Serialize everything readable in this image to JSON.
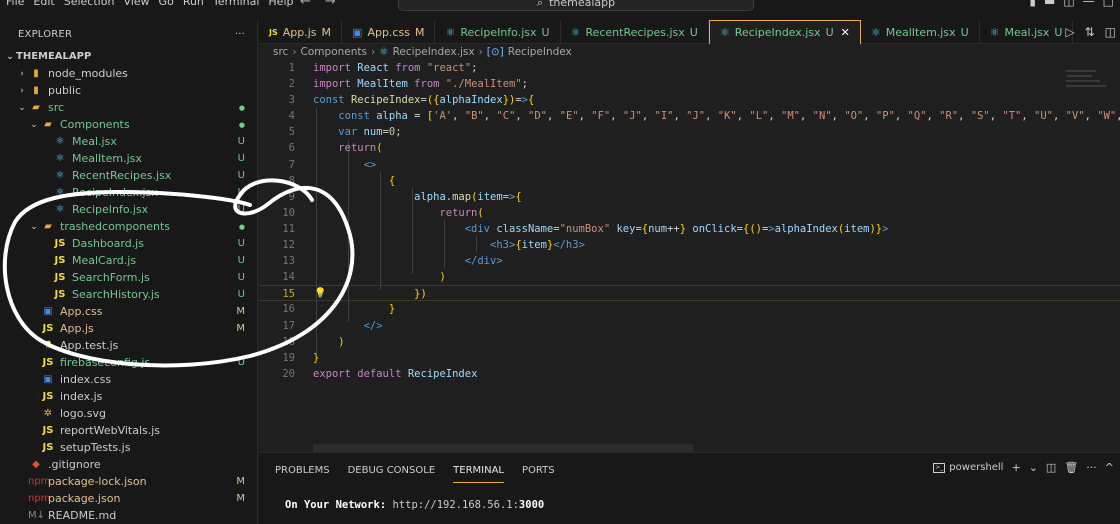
{
  "menu": [
    "File",
    "Edit",
    "Selection",
    "View",
    "Go",
    "Run",
    "Terminal",
    "Help"
  ],
  "command_center": "themealapp",
  "sidebar": {
    "title": "EXPLORER",
    "more": "···",
    "root": "THEMEALAPP",
    "items": [
      {
        "label": "node_modules",
        "indent": 1,
        "arrow": "›",
        "icon": "folder-icon",
        "color": "#cccccc",
        "status": ""
      },
      {
        "label": "public",
        "indent": 1,
        "arrow": "›",
        "icon": "folder-icon",
        "color": "#cccccc",
        "status": ""
      },
      {
        "label": "src",
        "indent": 1,
        "arrow": "⌄",
        "icon": "folder-open-icon",
        "color": "#73c991",
        "status": "●"
      },
      {
        "label": "Components",
        "indent": 2,
        "arrow": "⌄",
        "icon": "folder-open-icon",
        "color": "#73c991",
        "status": "●"
      },
      {
        "label": "Meal.jsx",
        "indent": 3,
        "arrow": "",
        "icon": "react-icon",
        "color": "#73c991",
        "status": "U"
      },
      {
        "label": "MealItem.jsx",
        "indent": 3,
        "arrow": "",
        "icon": "react-icon",
        "color": "#73c991",
        "status": "U"
      },
      {
        "label": "RecentRecipes.jsx",
        "indent": 3,
        "arrow": "",
        "icon": "react-icon",
        "color": "#73c991",
        "status": "U"
      },
      {
        "label": "RecipeIndex.jsx",
        "indent": 3,
        "arrow": "",
        "icon": "react-icon",
        "color": "#73c991",
        "status": "U"
      },
      {
        "label": "RecipeInfo.jsx",
        "indent": 3,
        "arrow": "",
        "icon": "react-icon",
        "color": "#73c991",
        "status": "U"
      },
      {
        "label": "trashedcomponents",
        "indent": 2,
        "arrow": "⌄",
        "icon": "folder-open-icon",
        "color": "#73c991",
        "status": "●"
      },
      {
        "label": "Dashboard.js",
        "indent": 3,
        "arrow": "",
        "icon": "js-icon",
        "color": "#73c991",
        "status": "U"
      },
      {
        "label": "MealCard.js",
        "indent": 3,
        "arrow": "",
        "icon": "js-icon",
        "color": "#73c991",
        "status": "U"
      },
      {
        "label": "SearchForm.js",
        "indent": 3,
        "arrow": "",
        "icon": "js-icon",
        "color": "#73c991",
        "status": "U"
      },
      {
        "label": "SearchHistory.js",
        "indent": 3,
        "arrow": "",
        "icon": "js-icon",
        "color": "#73c991",
        "status": "U"
      },
      {
        "label": "App.css",
        "indent": 2,
        "arrow": "",
        "icon": "css-icon",
        "color": "#e2c08d",
        "status": "M"
      },
      {
        "label": "App.js",
        "indent": 2,
        "arrow": "",
        "icon": "js-icon",
        "color": "#e2c08d",
        "status": "M"
      },
      {
        "label": "App.test.js",
        "indent": 2,
        "arrow": "",
        "icon": "test-icon",
        "color": "#cccccc",
        "status": ""
      },
      {
        "label": "firebaseconfig.js",
        "indent": 2,
        "arrow": "",
        "icon": "js-icon",
        "color": "#73c991",
        "status": "U"
      },
      {
        "label": "index.css",
        "indent": 2,
        "arrow": "",
        "icon": "css-icon",
        "color": "#cccccc",
        "status": ""
      },
      {
        "label": "index.js",
        "indent": 2,
        "arrow": "",
        "icon": "js-icon",
        "color": "#cccccc",
        "status": ""
      },
      {
        "label": "logo.svg",
        "indent": 2,
        "arrow": "",
        "icon": "svg-icon",
        "color": "#cccccc",
        "status": ""
      },
      {
        "label": "reportWebVitals.js",
        "indent": 2,
        "arrow": "",
        "icon": "js-icon",
        "color": "#cccccc",
        "status": ""
      },
      {
        "label": "setupTests.js",
        "indent": 2,
        "arrow": "",
        "icon": "js-icon",
        "color": "#cccccc",
        "status": ""
      },
      {
        "label": ".gitignore",
        "indent": 1,
        "arrow": "",
        "icon": "git-icon",
        "color": "#cccccc",
        "status": ""
      },
      {
        "label": "package-lock.json",
        "indent": 1,
        "arrow": "",
        "icon": "npm-icon",
        "color": "#e2c08d",
        "status": "M"
      },
      {
        "label": "package.json",
        "indent": 1,
        "arrow": "",
        "icon": "npm-icon",
        "color": "#e2c08d",
        "status": "M"
      },
      {
        "label": "README.md",
        "indent": 1,
        "arrow": "",
        "icon": "markdown-icon",
        "color": "#cccccc",
        "status": ""
      }
    ]
  },
  "tabs": [
    {
      "label": "App.js",
      "status": "M",
      "icon": "js-icon",
      "active": false
    },
    {
      "label": "App.css",
      "status": "M",
      "icon": "css-icon",
      "active": false
    },
    {
      "label": "RecipeInfo.jsx",
      "status": "U",
      "icon": "react-icon",
      "active": false
    },
    {
      "label": "RecentRecipes.jsx",
      "status": "U",
      "icon": "react-icon",
      "active": false
    },
    {
      "label": "RecipeIndex.jsx",
      "status": "U",
      "icon": "react-icon",
      "active": true
    },
    {
      "label": "MealItem.jsx",
      "status": "U",
      "icon": "react-icon",
      "active": false
    },
    {
      "label": "Meal.jsx",
      "status": "U",
      "icon": "react-icon",
      "active": false
    }
  ],
  "breadcrumb": [
    "src",
    "Components",
    "RecipeIndex.jsx",
    "RecipeIndex"
  ],
  "code": {
    "active_line": 15,
    "line_numbers": [
      "1",
      "2",
      "3",
      "4",
      "5",
      "6",
      "7",
      "8",
      "9",
      "10",
      "11",
      "12",
      "13",
      "14",
      "15",
      "16",
      "17",
      "18",
      "19",
      "20"
    ],
    "lines": [
      "import React from \"react\";",
      "import MealItem from \"./MealItem\";",
      "const RecipeIndex=({alphaIndex})=>{",
      "    const alpha = ['A', \"B\", \"C\", \"D\", \"E\", \"F\", \"J\", \"I\", \"J\", \"K\", \"L\", \"M\", \"N\", \"O\", \"P\", \"Q\", \"R\", \"S\", \"T\", \"U\", \"V\", \"W\",",
      "    var num=0;",
      "    return(",
      "        <>",
      "            {",
      "                alpha.map(item=>{",
      "                    return(",
      "                        <div className=\"numBox\" key={num++} onClick={()=>alphaIndex(item)}>",
      "                            <h3>{item}</h3>",
      "                        </div>",
      "                    )",
      "                })",
      "            }",
      "        </>",
      "    )",
      "}",
      "export default RecipeIndex"
    ]
  },
  "panel": {
    "tabs": [
      "PROBLEMS",
      "DEBUG CONSOLE",
      "TERMINAL",
      "PORTS"
    ],
    "active_tab": "TERMINAL",
    "shell": "powershell",
    "terminal_label": "On Your Network:",
    "terminal_url_prefix": "http://192.168.56.1:",
    "terminal_port": "3000"
  },
  "colors": {
    "accent": "#e9a93c",
    "untracked": "#73c991",
    "modified": "#e2c08d",
    "background": "#1f1f1f",
    "sidebar": "#181818"
  }
}
